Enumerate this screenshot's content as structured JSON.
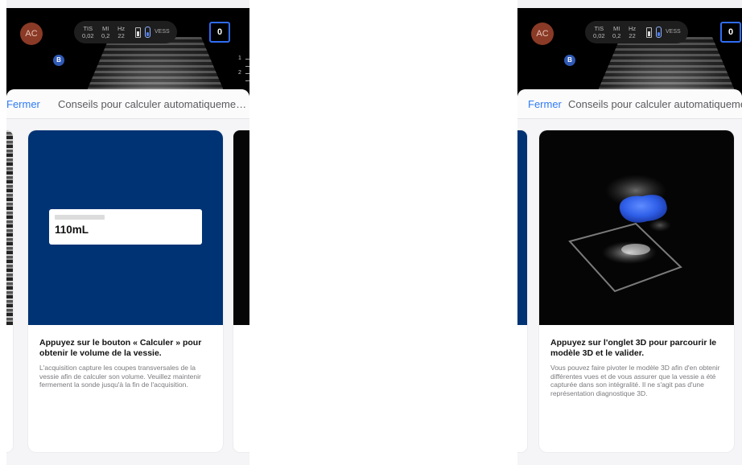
{
  "screens": [
    {
      "topbar": {
        "user_initials": "AC",
        "params": {
          "tis_label": "TIS",
          "tis_value": "0,02",
          "mi_label": "MI",
          "mi_value": "0,2",
          "hz_label": "Hz",
          "hz_value": "22"
        },
        "preset": "VESS",
        "count": "0",
        "marker": "B",
        "ruler": [
          "1",
          "2"
        ]
      },
      "sheet": {
        "close_label": "Fermer",
        "title": "Conseils pour calculer automatiquement le volume de la vessie"
      },
      "card": {
        "volume_value": "110mL",
        "heading": "Appuyez sur le bouton « Calculer » pour obtenir le volume de la vessie.",
        "text": "L'acquisition capture les coupes transversales de la vessie afin de calculer son volume. Veuillez maintenir fermement la sonde jusqu'à la fin de l'acquisition."
      }
    },
    {
      "topbar": {
        "user_initials": "AC",
        "params": {
          "tis_label": "TIS",
          "tis_value": "0,02",
          "mi_label": "MI",
          "mi_value": "0,2",
          "hz_label": "Hz",
          "hz_value": "22"
        },
        "preset": "VESS",
        "count": "0",
        "marker": "B"
      },
      "sheet": {
        "close_label": "Fermer",
        "title": "Conseils pour calculer automatiquement le volume de la vessie"
      },
      "card": {
        "heading": "Appuyez sur l'onglet 3D pour parcourir le modèle 3D et le valider.",
        "text": "Vous pouvez faire pivoter le modèle 3D afin d'en obtenir différentes vues et de vous assurer que la vessie a été capturée dans son intégralité. Il ne s'agit pas d'une représentation diagnostique 3D."
      }
    }
  ],
  "colors": {
    "accent": "#2f7bf6",
    "card_blue": "#003374",
    "bladder_blue": "#2f5fe8",
    "avatar": "#8a3a26"
  }
}
